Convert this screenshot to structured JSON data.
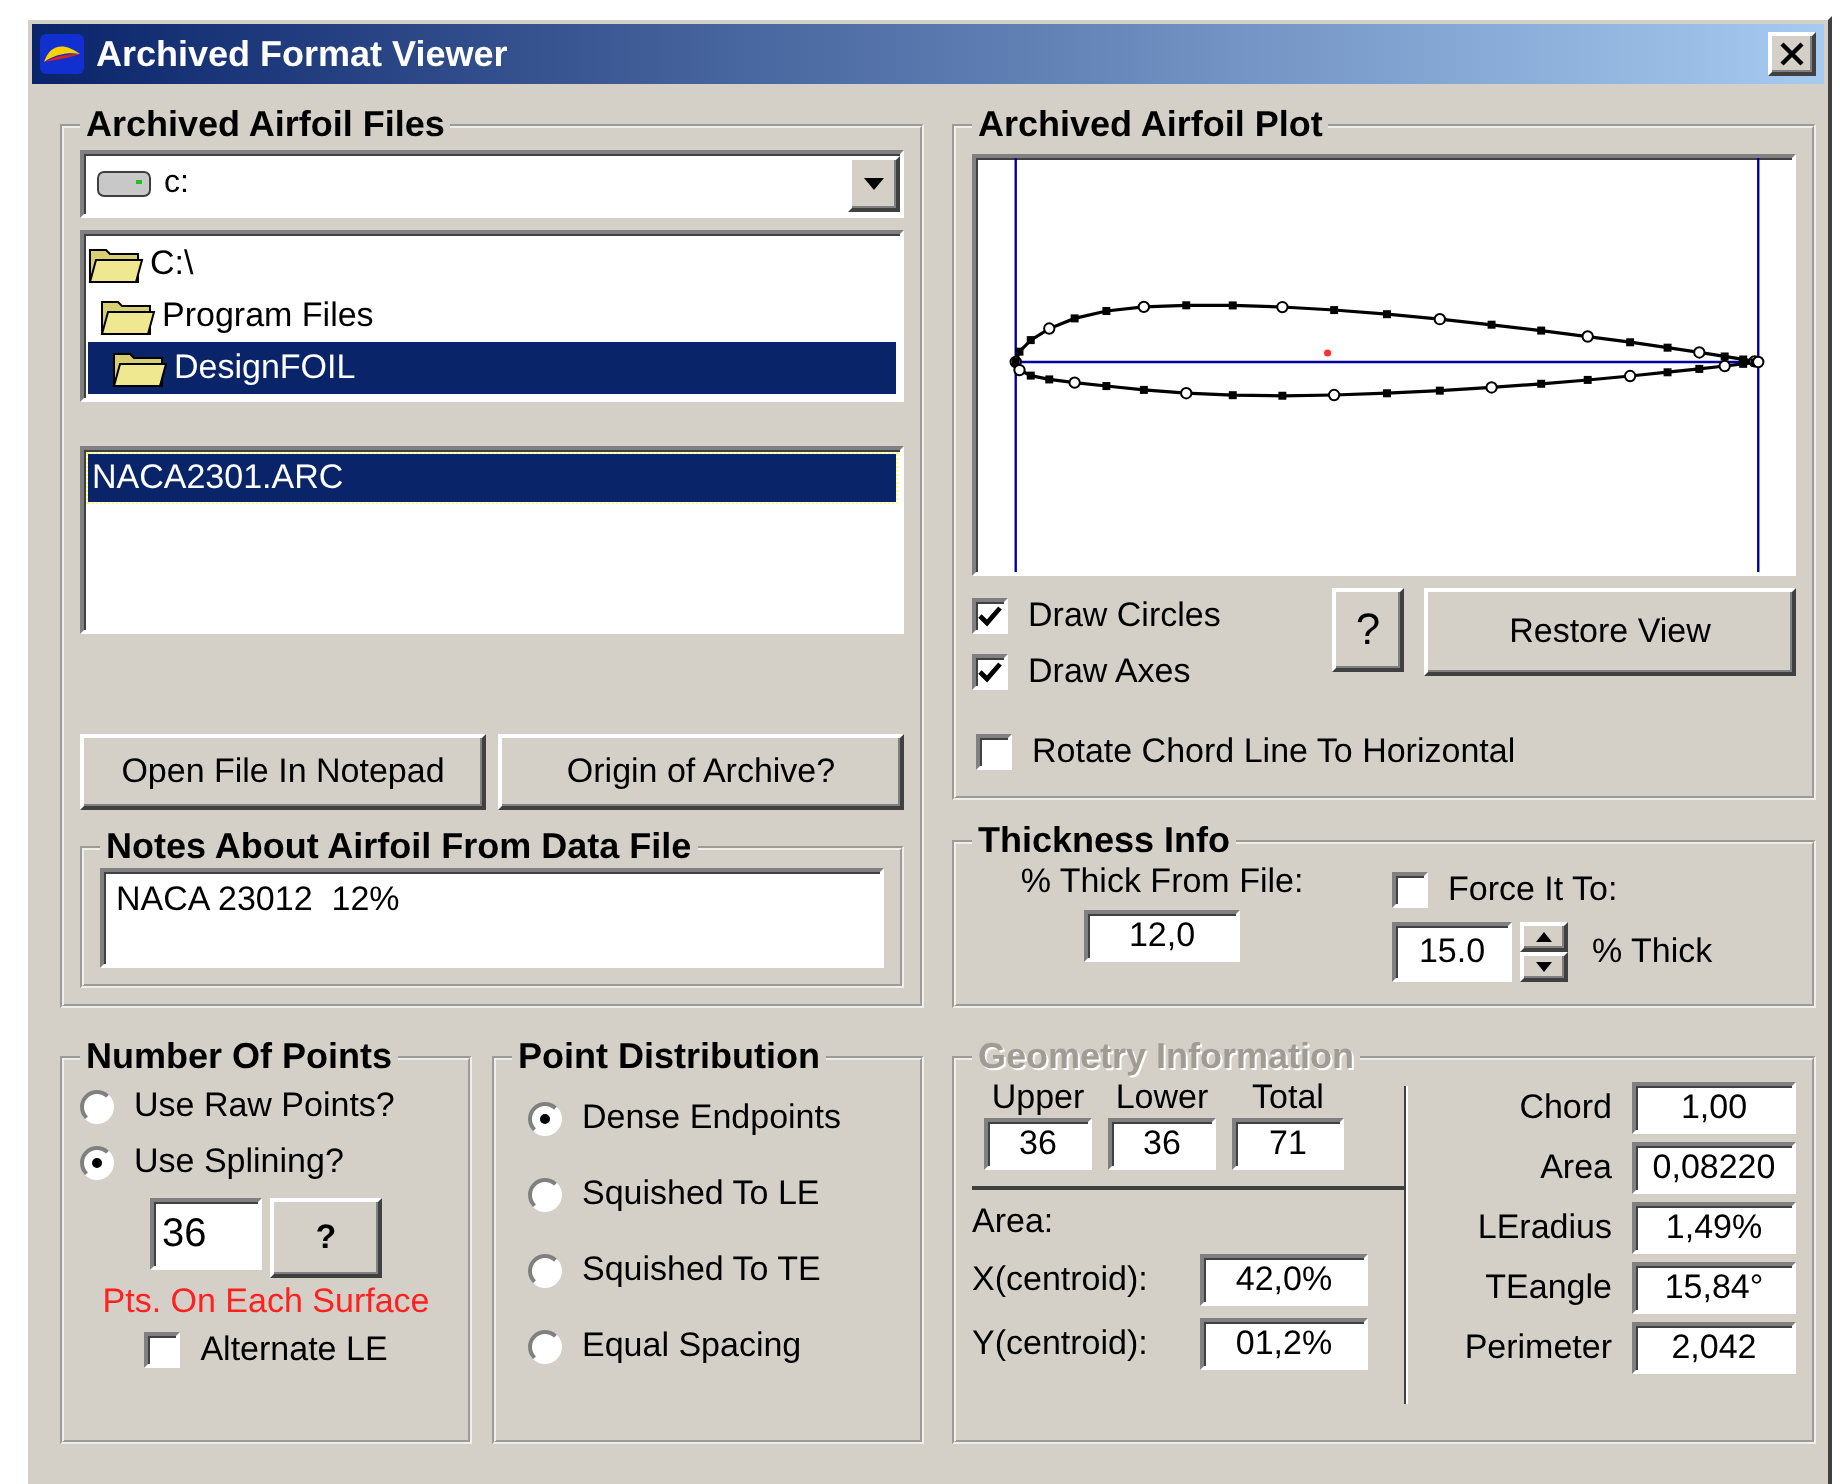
{
  "window": {
    "title": "Archived Format Viewer"
  },
  "files_group": {
    "title": "Archived Airfoil Files",
    "drive": "c:",
    "folders": [
      {
        "label": "C:\\",
        "selected": false,
        "children": [
          {
            "label": "Program Files",
            "selected": false,
            "children": [
              {
                "label": "DesignFOIL",
                "selected": true
              }
            ]
          }
        ]
      }
    ],
    "files": [
      {
        "label": "NACA2301.ARC",
        "selected": true
      }
    ],
    "buttons": [
      "Open File In Notepad",
      "Origin of Archive?"
    ],
    "notes": {
      "title": "Notes About Airfoil From Data File",
      "value": "NACA 23012  12%"
    }
  },
  "plot": {
    "title": "Archived Airfoil Plot",
    "options": [
      {
        "label": "Draw Circles",
        "checked": true
      },
      {
        "label": "Draw Axes",
        "checked": true
      },
      {
        "label": "Rotate Chord Line To Horizontal",
        "checked": false
      }
    ],
    "help_button": "?",
    "restore_button": "Restore View"
  },
  "thickness": {
    "title": "Thickness Info",
    "from_file_label": "% Thick From File:",
    "from_file_value": "12,0",
    "force_label": "Force It To:",
    "force_checked": false,
    "force_value": "15.0",
    "unit": "% Thick"
  },
  "points": {
    "title": "Number Of Points",
    "modes": [
      {
        "label": "Use Raw Points?",
        "selected": false
      },
      {
        "label": "Use Splining?",
        "selected": true
      }
    ],
    "count": "36",
    "help_button": "?",
    "caption": "Pts. On Each Surface",
    "alternate": {
      "label": "Alternate LE",
      "checked": false
    }
  },
  "distribution": {
    "title": "Point Distribution",
    "options": [
      {
        "label": "Dense Endpoints",
        "selected": true
      },
      {
        "label": "Squished To LE",
        "selected": false
      },
      {
        "label": "Squished To TE",
        "selected": false
      },
      {
        "label": "Equal Spacing",
        "selected": false
      }
    ]
  },
  "geometry": {
    "title": "Geometry Information",
    "title_disabled": true,
    "counts": [
      {
        "label": "Upper",
        "value": "36"
      },
      {
        "label": "Lower",
        "value": "36"
      },
      {
        "label": "Total",
        "value": "71"
      }
    ],
    "area_label": "Area:",
    "centroids": [
      {
        "label": "X(centroid):",
        "value": "42,0%"
      },
      {
        "label": "Y(centroid):",
        "value": "01,2%"
      }
    ],
    "properties": [
      {
        "label": "Chord",
        "value": "1,00"
      },
      {
        "label": "Area",
        "value": "0,08220"
      },
      {
        "label": "LEradius",
        "value": "1,49%"
      },
      {
        "label": "TEangle",
        "value": "15,84°"
      },
      {
        "label": "Perimeter",
        "value": "2,042"
      }
    ]
  }
}
